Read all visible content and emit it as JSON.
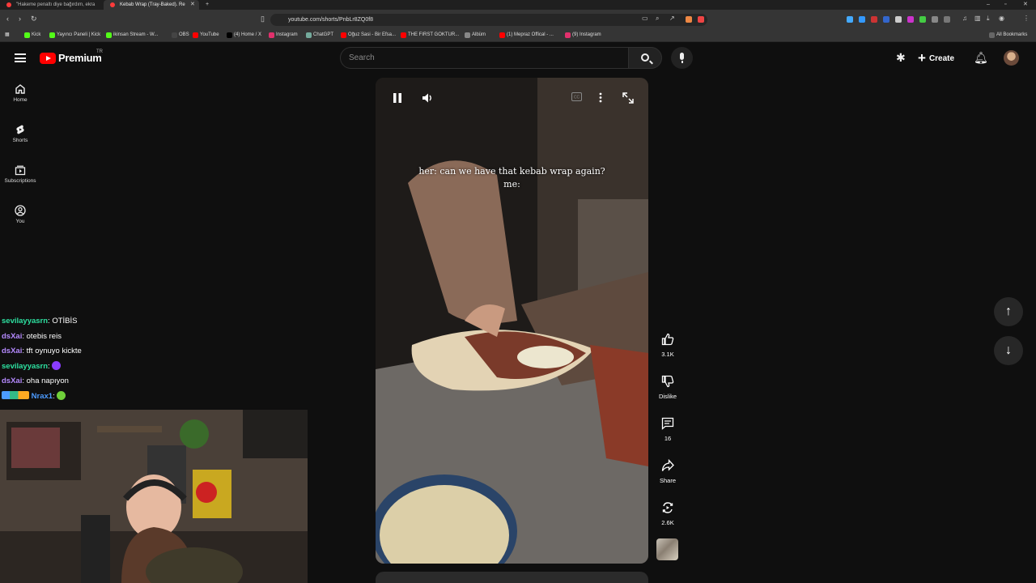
{
  "browser": {
    "tabs": [
      {
        "title": "\"Hakeme penaltı diye bağırdım, ekra",
        "active": false
      },
      {
        "title": "Kebab Wrap (Tray-Baked). Re",
        "active": true
      }
    ],
    "new_tab_icon": "plus-icon",
    "url": "youtube.com/shorts/PnbLr8ZQ0f8",
    "bookmarks": [
      {
        "label": "Kick",
        "color": "#53fc18"
      },
      {
        "label": "Yayıncı Paneli | Kick",
        "color": "#53fc18"
      },
      {
        "label": "ikinsan Stream - W...",
        "color": "#53fc18"
      },
      {
        "label": "OBS",
        "color": "#444444"
      },
      {
        "label": "YouTube",
        "color": "#ff0000"
      },
      {
        "label": "(4) Home / X",
        "color": "#000000"
      },
      {
        "label": "Instagram",
        "color": "#e1306c"
      },
      {
        "label": "ChatGPT",
        "color": "#74aa9c"
      },
      {
        "label": "Oğuz Sasi - Bir Efsa...",
        "color": "#ff0000"
      },
      {
        "label": "THE FIRST GOKTUR...",
        "color": "#ff0000"
      },
      {
        "label": "Albüm",
        "color": "#888888"
      },
      {
        "label": "(1) Mepraz Offical - ...",
        "color": "#ff0000"
      },
      {
        "label": "(9) Instagram",
        "color": "#e1306c"
      }
    ],
    "all_bookmarks": "All Bookmarks"
  },
  "youtube": {
    "logo_text": "Premium",
    "country_code": "TR",
    "search_placeholder": "Search",
    "create_label": "Create",
    "brand_color": "#ff0000"
  },
  "sidenav": [
    {
      "label": "Home",
      "icon": "home-icon"
    },
    {
      "label": "Shorts",
      "icon": "shorts-icon"
    },
    {
      "label": "Subscriptions",
      "icon": "subscriptions-icon"
    },
    {
      "label": "You",
      "icon": "you-icon"
    }
  ],
  "chat": [
    {
      "user": "sevilayyasrn",
      "message": "OTİBİS",
      "color": "#2de0a0"
    },
    {
      "user": "dsXai",
      "message": "otebis reis",
      "color": "#b58aff"
    },
    {
      "user": "dsXai",
      "message": "tft oynuyo kickte",
      "color": "#b58aff"
    },
    {
      "user": "sevilayyasrn",
      "message": "",
      "color": "#2de0a0"
    },
    {
      "user": "dsXai",
      "message": "oha napıyon",
      "color": "#b58aff"
    },
    {
      "user": "Nrax1",
      "message": "",
      "color": "#4c9bff"
    }
  ],
  "short": {
    "caption_line1": "her: can we have that kebab wrap again?",
    "caption_line2": "me:",
    "like_count": "3.1K",
    "dislike_label": "Dislike",
    "comment_count": "16",
    "share_label": "Share",
    "remix_count": "2.6K"
  }
}
